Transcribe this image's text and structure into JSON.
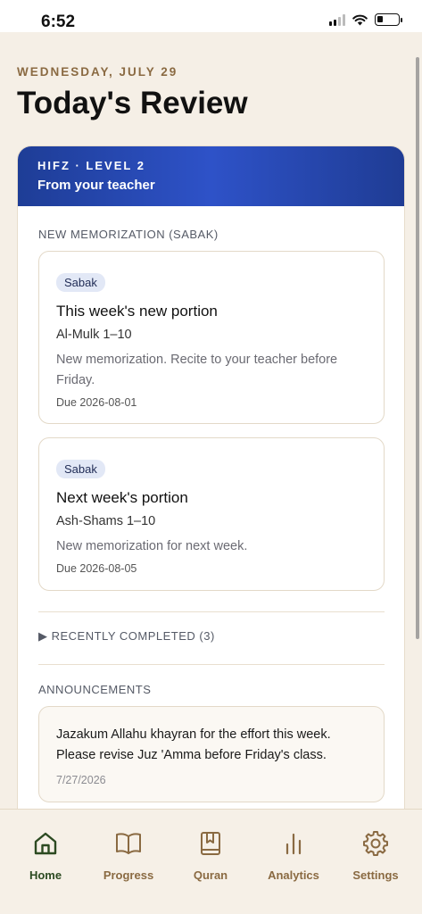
{
  "status_bar": {
    "time": "6:52"
  },
  "header": {
    "date": "WEDNESDAY, JULY 29",
    "title": "Today's Review"
  },
  "program": {
    "level": "HIFZ · LEVEL 2",
    "subtitle": "From your teacher"
  },
  "new_memorization": {
    "section_label": "NEW MEMORIZATION (SABAK)",
    "items": [
      {
        "badge": "Sabak",
        "title": "This week's new portion",
        "reference": "Al-Mulk 1–10",
        "description": "New memorization. Recite to your teacher before Friday.",
        "due": "Due 2026-08-01"
      },
      {
        "badge": "Sabak",
        "title": "Next week's portion",
        "reference": "Ash-Shams 1–10",
        "description": "New memorization for next week.",
        "due": "Due 2026-08-05"
      }
    ]
  },
  "recently_completed": {
    "label": "▶ RECENTLY COMPLETED (3)"
  },
  "announcements": {
    "section_label": "ANNOUNCEMENTS",
    "items": [
      {
        "text": "Jazakum Allahu khayran for the effort this week. Please revise Juz 'Amma before Friday's class.",
        "date": "7/27/2026"
      }
    ]
  },
  "nav": {
    "items": [
      {
        "label": "Home",
        "icon": "home-icon"
      },
      {
        "label": "Progress",
        "icon": "book-open-icon"
      },
      {
        "label": "Quran",
        "icon": "bookmark-book-icon"
      },
      {
        "label": "Analytics",
        "icon": "bar-chart-icon"
      },
      {
        "label": "Settings",
        "icon": "gear-icon"
      }
    ],
    "active": "Home"
  },
  "colors": {
    "background": "#f5efe6",
    "accent_brown": "#8a6a42",
    "header_blue": "#2e52c8",
    "active_green": "#2c4a21"
  }
}
